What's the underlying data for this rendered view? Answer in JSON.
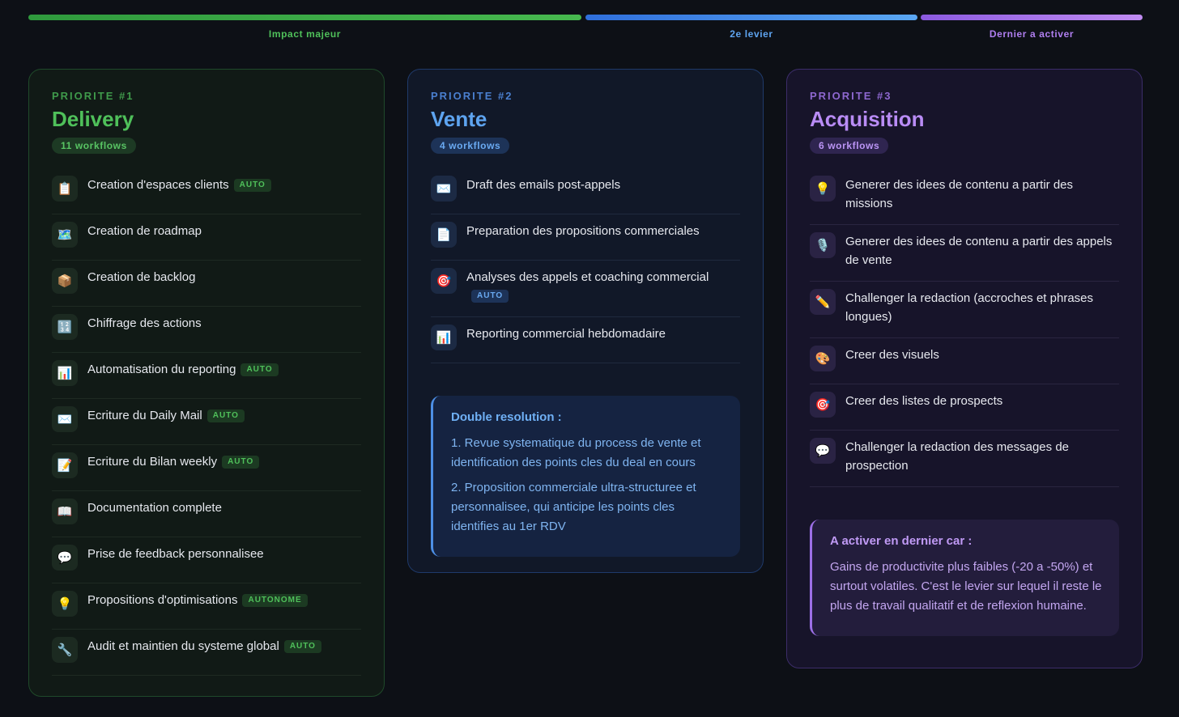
{
  "bars": {
    "impact_label": "Impact majeur",
    "lever2_label": "2e levier",
    "last_label": "Dernier a activer"
  },
  "delivery": {
    "priority": "PRIORITE #1",
    "title": "Delivery",
    "count": "11 workflows",
    "items": [
      {
        "icon": "clipboard-icon",
        "glyph": "📋",
        "label": "Creation d'espaces clients",
        "badge": "AUTO"
      },
      {
        "icon": "map-icon",
        "glyph": "🗺️",
        "label": "Creation de roadmap",
        "badge": ""
      },
      {
        "icon": "package-icon",
        "glyph": "📦",
        "label": "Creation de backlog",
        "badge": ""
      },
      {
        "icon": "numbers-icon",
        "glyph": "🔢",
        "label": "Chiffrage des actions",
        "badge": ""
      },
      {
        "icon": "bar-chart-icon",
        "glyph": "📊",
        "label": "Automatisation du reporting",
        "badge": "AUTO"
      },
      {
        "icon": "envelope-icon",
        "glyph": "✉️",
        "label": "Ecriture du Daily Mail",
        "badge": "AUTO"
      },
      {
        "icon": "memo-icon",
        "glyph": "📝",
        "label": "Ecriture du Bilan weekly",
        "badge": "AUTO"
      },
      {
        "icon": "book-icon",
        "glyph": "📖",
        "label": "Documentation complete",
        "badge": ""
      },
      {
        "icon": "speech-bubble-icon",
        "glyph": "💬",
        "label": "Prise de feedback personnalisee",
        "badge": ""
      },
      {
        "icon": "lightbulb-icon",
        "glyph": "💡",
        "label": "Propositions d'optimisations",
        "badge": "AUTONOME"
      },
      {
        "icon": "wrench-icon",
        "glyph": "🔧",
        "label": "Audit et maintien du systeme global",
        "badge": "AUTO"
      }
    ]
  },
  "vente": {
    "priority": "PRIORITE #2",
    "title": "Vente",
    "count": "4 workflows",
    "items": [
      {
        "icon": "envelope-icon",
        "glyph": "✉️",
        "label": "Draft des emails post-appels",
        "badge": ""
      },
      {
        "icon": "document-icon",
        "glyph": "📄",
        "label": "Preparation des propositions commerciales",
        "badge": ""
      },
      {
        "icon": "target-icon",
        "glyph": "🎯",
        "label": "Analyses des appels et coaching commercial",
        "badge": "AUTO"
      },
      {
        "icon": "bar-chart-icon",
        "glyph": "📊",
        "label": "Reporting commercial hebdomadaire",
        "badge": ""
      }
    ],
    "callout": {
      "title": "Double resolution :",
      "p1": "1. Revue systematique du process de vente et identification des points cles du deal en cours",
      "p2": "2. Proposition commerciale ultra-structuree et personnalisee, qui anticipe les points cles identifies au 1er RDV"
    }
  },
  "acquisition": {
    "priority": "PRIORITE #3",
    "title": "Acquisition",
    "count": "6 workflows",
    "items": [
      {
        "icon": "lightbulb-icon",
        "glyph": "💡",
        "label": "Generer des idees de contenu a partir des missions"
      },
      {
        "icon": "microphone-icon",
        "glyph": "🎙️",
        "label": "Generer des idees de contenu a partir des appels de vente"
      },
      {
        "icon": "pencil-icon",
        "glyph": "✏️",
        "label": "Challenger la redaction (accroches et phrases longues)"
      },
      {
        "icon": "palette-icon",
        "glyph": "🎨",
        "label": "Creer des visuels"
      },
      {
        "icon": "target-icon",
        "glyph": "🎯",
        "label": "Creer des listes de prospects"
      },
      {
        "icon": "speech-bubble-icon",
        "glyph": "💬",
        "label": "Challenger la redaction des messages de prospection"
      }
    ],
    "callout": {
      "title": "A activer en dernier car :",
      "p1": "Gains de productivite plus faibles (-20 a -50%) et surtout volatiles. C'est le levier sur lequel il reste le plus de travail qualitatif et de reflexion humaine."
    }
  },
  "colors": {
    "green": "#4fc05a",
    "blue": "#5ea4f0",
    "purple": "#b98cf5",
    "background": "#0d1016"
  }
}
